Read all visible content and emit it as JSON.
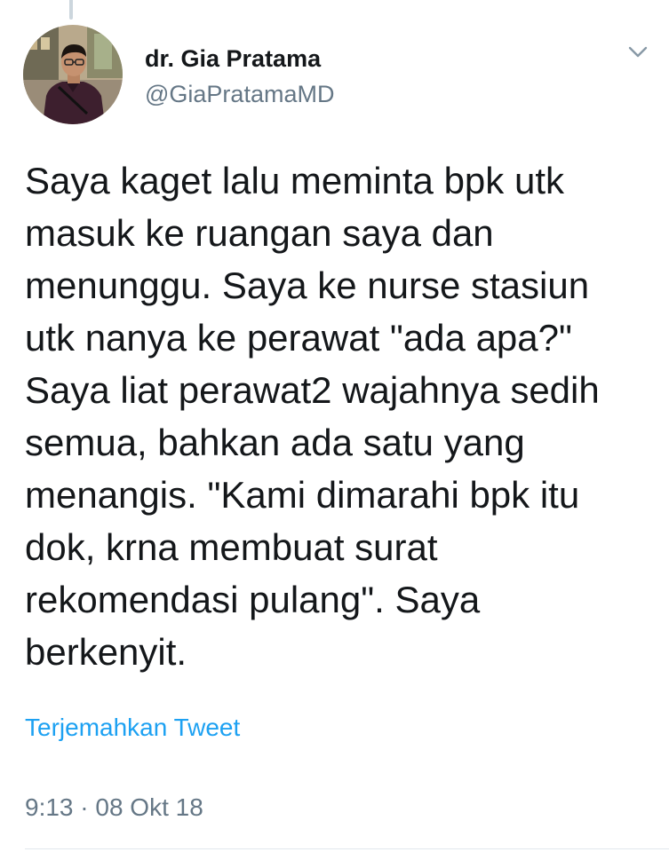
{
  "author": {
    "display_name": "dr. Gia Pratama",
    "handle": "@GiaPratamaMD",
    "avatar_icon": "profile-photo"
  },
  "menu": {
    "icon": "chevron-down-icon"
  },
  "tweet": {
    "lines": [
      "Saya kaget lalu meminta bpk utk",
      "masuk ke ruangan saya dan",
      "menunggu. Saya ke nurse stasiun",
      "utk nanya ke perawat \"ada apa?\"",
      "Saya liat perawat2 wajahnya sedih",
      "semua, bahkan ada satu yang",
      "menangis. \"Kami dimarahi bpk itu",
      "dok, krna membuat surat",
      "rekomendasi pulang\". Saya",
      "berkenyit."
    ],
    "translate_label": "Terjemahkan Tweet",
    "timestamp": "9:13 · 08 Okt 18"
  },
  "colors": {
    "link": "#1da1f2",
    "secondary_text": "#657786",
    "primary_text": "#14171a"
  }
}
